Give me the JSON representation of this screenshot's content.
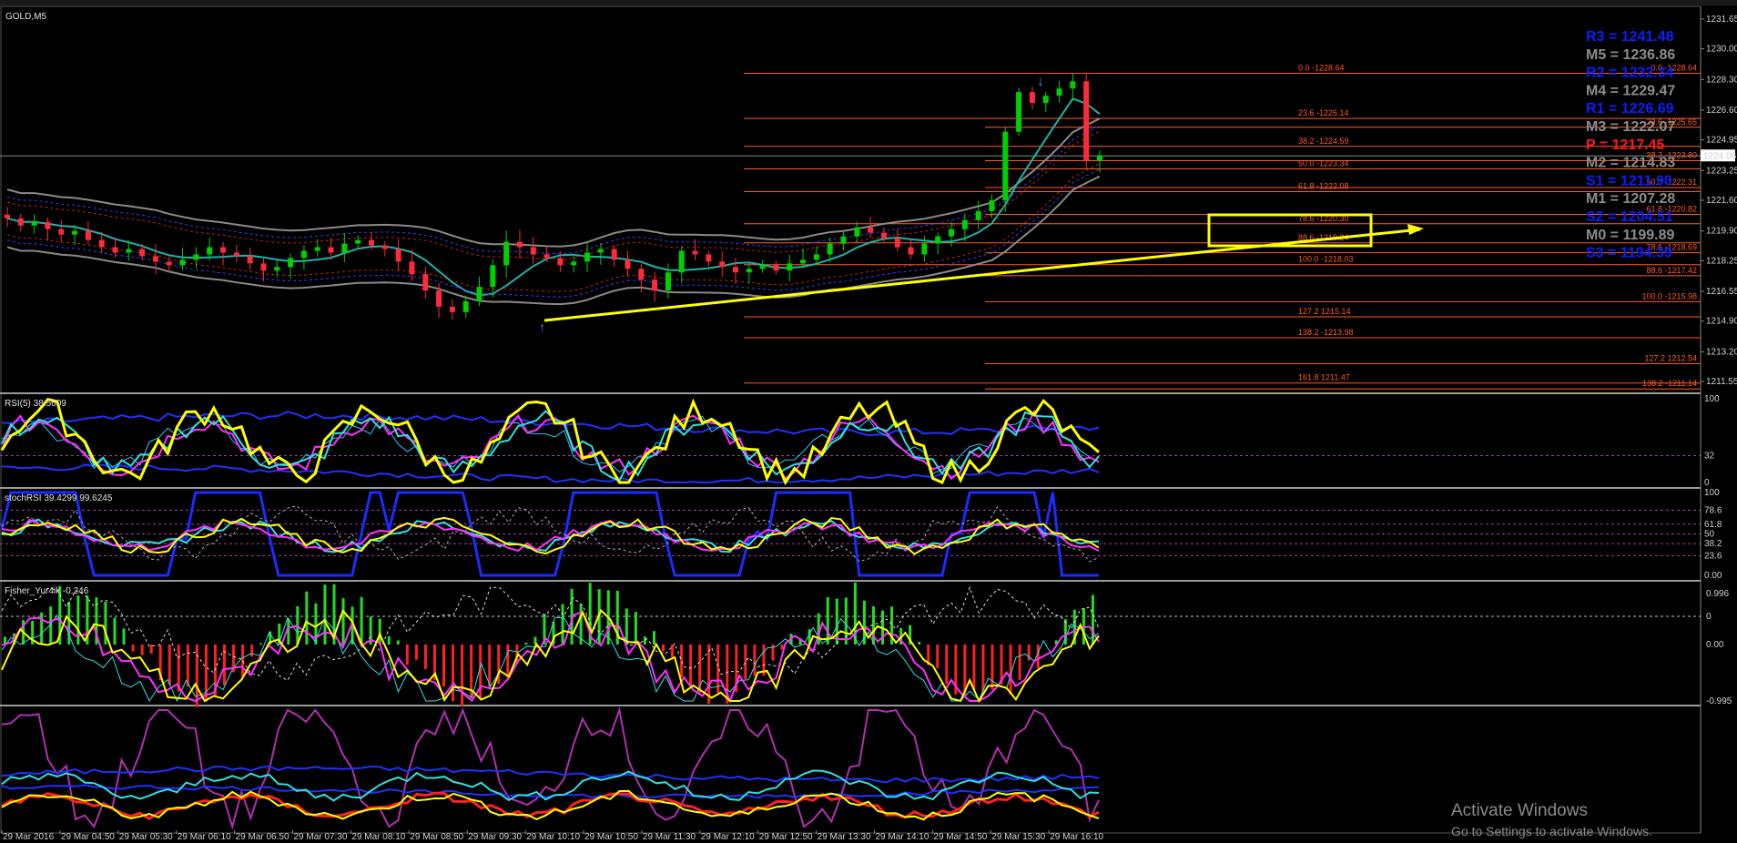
{
  "window": {
    "symbol_label": "GOLD,M5"
  },
  "chart_data": [
    {
      "type": "candlestick",
      "title": "GOLD,M5",
      "ylim": [
        1211.0,
        1232.0
      ],
      "y_ticks": [
        "1231.65",
        "1230.00",
        "1228.30",
        "1226.60",
        "1224.95",
        "1223.25",
        "1221.60",
        "1219.90",
        "1218.25",
        "1216.55",
        "1214.90",
        "1213.20",
        "1211.55"
      ],
      "current_price": "1224.06",
      "x_ticks": [
        "29 Mar 2016",
        "29 Mar 04:50",
        "29 Mar 05:30",
        "29 Mar 06:10",
        "29 Mar 06:50",
        "29 Mar 07:30",
        "29 Mar 08:10",
        "29 Mar 08:50",
        "29 Mar 09:30",
        "29 Mar 10:10",
        "29 Mar 10:50",
        "29 Mar 11:30",
        "29 Mar 12:10",
        "29 Mar 12:50",
        "29 Mar 13:30",
        "29 Mar 14:10",
        "29 Mar 14:50",
        "29 Mar 15:30",
        "29 Mar 16:10"
      ],
      "close_series": [
        1220.6,
        1220.2,
        1220.4,
        1220.0,
        1219.7,
        1219.9,
        1219.4,
        1219.0,
        1218.7,
        1218.9,
        1218.5,
        1218.2,
        1218.0,
        1218.3,
        1218.6,
        1219.0,
        1218.7,
        1218.5,
        1218.1,
        1217.7,
        1217.9,
        1218.4,
        1218.8,
        1219.0,
        1218.7,
        1219.2,
        1219.4,
        1219.1,
        1218.9,
        1218.2,
        1217.5,
        1216.6,
        1215.7,
        1215.4,
        1216.0,
        1216.8,
        1218.0,
        1219.3,
        1219.0,
        1218.6,
        1218.4,
        1218.0,
        1218.2,
        1218.7,
        1218.9,
        1218.3,
        1217.8,
        1217.2,
        1216.6,
        1217.6,
        1218.8,
        1218.6,
        1218.2,
        1217.9,
        1217.6,
        1217.8,
        1218.0,
        1217.7,
        1218.1,
        1218.3,
        1218.6,
        1219.2,
        1219.6,
        1220.1,
        1219.8,
        1219.5,
        1219.0,
        1218.6,
        1219.2,
        1219.6,
        1220.0,
        1220.5,
        1221.0,
        1221.6,
        1225.4,
        1227.6,
        1227.0,
        1227.4,
        1227.8,
        1228.2,
        1223.8,
        1224.1
      ],
      "fibonacci_levels": [
        {
          "label": "0.0 -1228.64",
          "price": 1228.64
        },
        {
          "label": "23.6 -1226.14",
          "price": 1226.14
        },
        {
          "label": "38.2 -1224.59",
          "price": 1224.59
        },
        {
          "label": "50.0 -1223.34",
          "price": 1223.34
        },
        {
          "label": "61.8 -1222.08",
          "price": 1222.08
        },
        {
          "label": "78.6 -1220.30",
          "price": 1220.3
        },
        {
          "label": "88.6 -1219.24",
          "price": 1219.24
        },
        {
          "label": "100.0 -1218.03",
          "price": 1218.03
        },
        {
          "label": "127.2 1215.14",
          "price": 1215.14
        },
        {
          "label": "138.2 -1213.98",
          "price": 1213.98
        },
        {
          "label": "161.8 1211.47",
          "price": 1211.47
        }
      ],
      "fibonacci_levels_2": [
        {
          "label": "0.0 -1228.64",
          "price": 1228.64
        },
        {
          "label": "23.6 -1225.65",
          "price": 1225.65
        },
        {
          "label": "38.2 -1223.80",
          "price": 1223.8
        },
        {
          "label": "50.0 -1222.31",
          "price": 1222.31
        },
        {
          "label": "61.8 -1220.82",
          "price": 1220.82
        },
        {
          "label": "78.6 -1218.69",
          "price": 1218.69
        },
        {
          "label": "88.6 -1217.42",
          "price": 1217.42
        },
        {
          "label": "100.0 -1215.98",
          "price": 1215.98
        },
        {
          "label": "127.2 1212.54",
          "price": 1212.54
        },
        {
          "label": "138.2 -1211.14",
          "price": 1211.14
        }
      ],
      "pivot_levels": [
        {
          "label": "R3 = 1241.48",
          "color": "#0a1fff"
        },
        {
          "label": "M5 = 1236.86",
          "color": "#8c8c8c"
        },
        {
          "label": "R2 = 1232.34",
          "color": "#0a1fff"
        },
        {
          "label": "M4 = 1229.47",
          "color": "#8c8c8c"
        },
        {
          "label": "R1 = 1226.69",
          "color": "#0a1fff"
        },
        {
          "label": "M3 = 1222.07",
          "color": "#8c8c8c"
        },
        {
          "label": "P = 1217.45",
          "color": "#ff1a1a"
        },
        {
          "label": "M2 = 1214.83",
          "color": "#8c8c8c"
        },
        {
          "label": "S1 = 1211.90",
          "color": "#0a1fff"
        },
        {
          "label": "M1 = 1207.28",
          "color": "#8c8c8c"
        },
        {
          "label": "S2 = 1204.51",
          "color": "#0a1fff"
        },
        {
          "label": "M0 = 1199.89",
          "color": "#8c8c8c"
        },
        {
          "label": "S3 = 1194.39",
          "color": "#0a1fff"
        }
      ]
    },
    {
      "type": "line",
      "title": "RSI(5) 38.5609",
      "ylim": [
        0,
        100
      ],
      "y_ticks": [
        "100",
        "32",
        "0"
      ],
      "level": 32
    },
    {
      "type": "line",
      "title": "stochRSI 39.4299 99.6245",
      "ylim": [
        0,
        100
      ],
      "y_ticks": [
        "100",
        "78.6",
        "61.8",
        "50",
        "38.2",
        "23.6",
        "0.00"
      ]
    },
    {
      "type": "bar",
      "title": "Fisher_Yur4ik -0.246",
      "ylim": [
        -0.995,
        0.996
      ],
      "y_ticks": [
        "0.996",
        "0",
        "0.00",
        "-0.995"
      ]
    },
    {
      "type": "line",
      "title": "",
      "ylim": [
        0,
        100
      ]
    }
  ],
  "watermark": {
    "title": "Activate Windows",
    "subtitle": "Go to Settings to activate Windows."
  },
  "colors": {
    "background": "#000000",
    "bull": "#00d000",
    "bear": "#ff2a3c",
    "fib": "#ff5a28",
    "trend": "#ffff00",
    "rsi": "#ffff00",
    "grid_divider": "#9a9a9a"
  }
}
